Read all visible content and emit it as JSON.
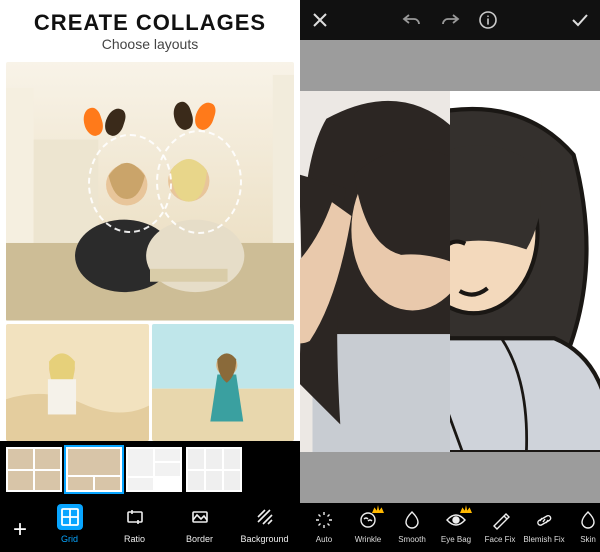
{
  "left": {
    "title": "CREATE COLLAGES",
    "subtitle": "Choose layouts",
    "toolbar": {
      "add_label": "+",
      "items": [
        {
          "id": "grid",
          "label": "Grid",
          "selected": true
        },
        {
          "id": "ratio",
          "label": "Ratio",
          "selected": false
        },
        {
          "id": "border",
          "label": "Border",
          "selected": false
        },
        {
          "id": "background",
          "label": "Background",
          "selected": false
        }
      ]
    },
    "layouts_selected_index": 1
  },
  "right": {
    "tools": [
      {
        "id": "auto",
        "label": "Auto",
        "premium": false
      },
      {
        "id": "wrinkle",
        "label": "Wrinkle",
        "premium": true
      },
      {
        "id": "smooth",
        "label": "Smooth",
        "premium": false
      },
      {
        "id": "eyebag",
        "label": "Eye Bag",
        "premium": true
      },
      {
        "id": "facefix",
        "label": "Face Fix",
        "premium": false
      },
      {
        "id": "blemishfix",
        "label": "Blemish Fix",
        "premium": false
      },
      {
        "id": "skin",
        "label": "Skin",
        "premium": false
      }
    ]
  },
  "colors": {
    "accent": "#08a5ff",
    "premium": "#ffb800"
  }
}
